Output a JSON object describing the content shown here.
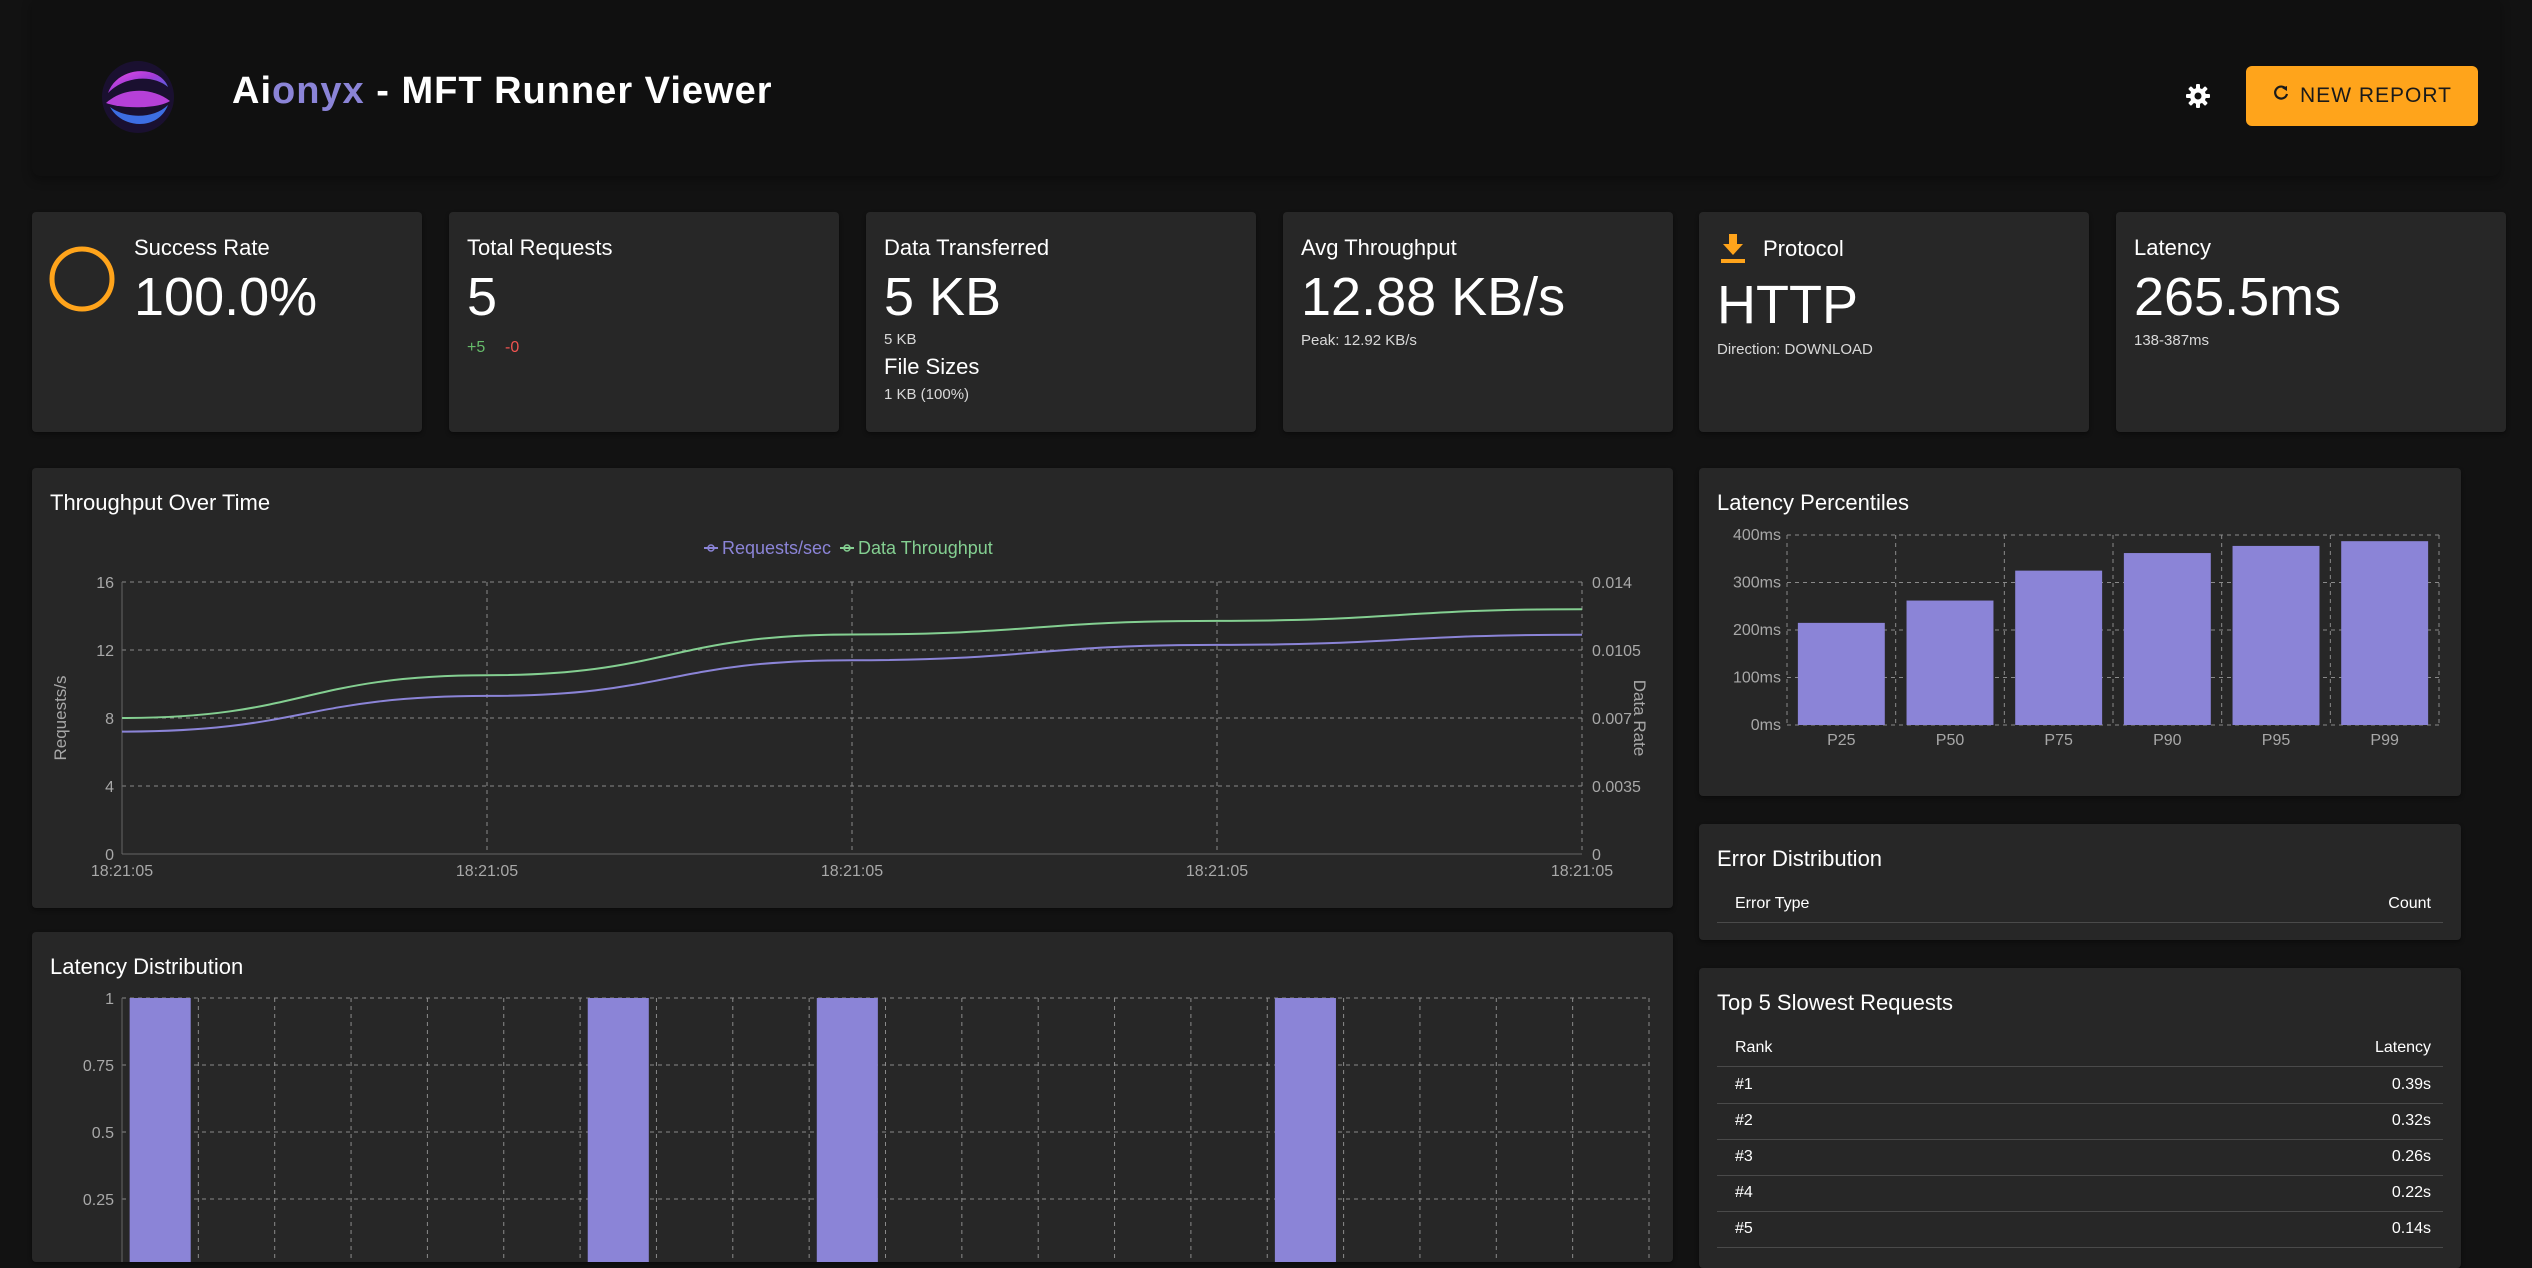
{
  "header": {
    "brand_ai": "Ai",
    "brand_onyx": "onyx",
    "brand_rest": " - MFT Runner Viewer",
    "new_report_label": "NEW REPORT",
    "logo_icon": "aionyx-swirl-logo",
    "settings_icon": "gear-icon",
    "refresh_icon": "refresh-icon"
  },
  "colors": {
    "accent": "#ffa41b",
    "purple": "#8b84d7",
    "green": "#84cf91",
    "positive": "#66bb6a",
    "negative": "#ef5350"
  },
  "stats": {
    "success": {
      "label": "Success Rate",
      "value": "100.0%",
      "ring_fraction": 1.0
    },
    "requests": {
      "label": "Total Requests",
      "value": "5",
      "delta_pos": "+5",
      "delta_neg": "-0"
    },
    "data": {
      "label": "Data Transferred",
      "value": "5 KB",
      "sub": "5 KB",
      "file_sizes_label": "File Sizes",
      "file_sizes_value": "1 KB (100%)"
    },
    "throughput": {
      "label": "Avg Throughput",
      "value": "12.88 KB/s",
      "sub": "Peak: 12.92 KB/s"
    },
    "protocol": {
      "label": "Protocol",
      "value": "HTTP",
      "sub": "Direction: DOWNLOAD",
      "icon": "download-icon"
    },
    "latency": {
      "label": "Latency",
      "value": "265.5ms",
      "sub": "138-387ms"
    }
  },
  "throughput_chart": {
    "title": "Throughput Over Time",
    "legend": [
      "Requests/sec",
      "Data Throughput"
    ],
    "y_left_label": "Requests/s",
    "y_right_label": "Data Rate",
    "y_left_ticks": [
      "16",
      "12",
      "8",
      "4",
      "0"
    ],
    "y_right_ticks": [
      "0.014",
      "0.0105",
      "0.007",
      "0.0035",
      "0"
    ],
    "x_ticks": [
      "18:21:05",
      "18:21:05",
      "18:21:05",
      "18:21:05",
      "18:21:05"
    ]
  },
  "latency_percentiles": {
    "title": "Latency Percentiles",
    "y_ticks": [
      "400ms",
      "300ms",
      "200ms",
      "100ms",
      "0ms"
    ]
  },
  "latency_distribution": {
    "title": "Latency Distribution",
    "y_ticks": [
      "1",
      "0.75",
      "0.5",
      "0.25"
    ]
  },
  "error_distribution": {
    "title": "Error Distribution",
    "col_type": "Error Type",
    "col_count": "Count"
  },
  "slowest": {
    "title": "Top 5 Slowest Requests",
    "col_rank": "Rank",
    "col_latency": "Latency",
    "rows": [
      {
        "rank": "#1",
        "latency": "0.39s"
      },
      {
        "rank": "#2",
        "latency": "0.32s"
      },
      {
        "rank": "#3",
        "latency": "0.26s"
      },
      {
        "rank": "#4",
        "latency": "0.22s"
      },
      {
        "rank": "#5",
        "latency": "0.14s"
      }
    ]
  },
  "chart_data": [
    {
      "type": "line",
      "title": "Throughput Over Time",
      "x": [
        "18:21:05",
        "18:21:05",
        "18:21:05",
        "18:21:05",
        "18:21:05"
      ],
      "series": [
        {
          "name": "Requests/sec",
          "axis": "left",
          "values": [
            7.2,
            9.3,
            11.4,
            12.3,
            12.9
          ]
        },
        {
          "name": "Data Throughput",
          "axis": "right",
          "values": [
            0.007,
            0.0092,
            0.0113,
            0.012,
            0.0126
          ]
        }
      ],
      "ylabel": "Requests/s",
      "y2label": "Data Rate",
      "ylim": [
        0,
        16
      ],
      "y2lim": [
        0,
        0.014
      ],
      "grid": true,
      "legend": "top-center"
    },
    {
      "type": "bar",
      "title": "Latency Percentiles",
      "categories": [
        "P25",
        "P50",
        "P75",
        "P90",
        "P95",
        "P99"
      ],
      "values": [
        215,
        262,
        325,
        362,
        377,
        387
      ],
      "ylim": [
        0,
        400
      ],
      "grid": true
    },
    {
      "type": "bar",
      "title": "Latency Distribution",
      "bins": 20,
      "values": [
        1,
        0,
        0,
        0,
        0,
        0,
        1,
        0,
        0,
        1,
        0,
        0,
        0,
        0,
        0,
        1,
        0,
        0,
        0,
        0
      ],
      "ylim": [
        0,
        1
      ],
      "grid": true
    }
  ]
}
